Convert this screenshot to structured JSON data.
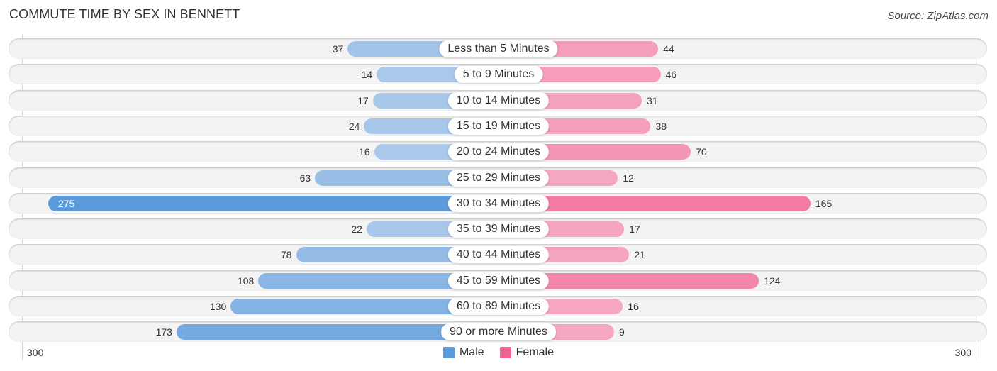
{
  "chart_data": {
    "type": "bar",
    "orientation": "horizontal-diverging",
    "title": "COMMUTE TIME BY SEX IN BENNETT",
    "source": "Source: ZipAtlas.com",
    "categories": [
      "Less than 5 Minutes",
      "5 to 9 Minutes",
      "10 to 14 Minutes",
      "15 to 19 Minutes",
      "20 to 24 Minutes",
      "25 to 29 Minutes",
      "30 to 34 Minutes",
      "35 to 39 Minutes",
      "40 to 44 Minutes",
      "45 to 59 Minutes",
      "60 to 89 Minutes",
      "90 or more Minutes"
    ],
    "series": [
      {
        "name": "Male",
        "color": "#5b9bdc",
        "light_color": "#aecbeb",
        "values": [
          37,
          14,
          17,
          24,
          16,
          63,
          275,
          22,
          78,
          108,
          130,
          173
        ]
      },
      {
        "name": "Female",
        "color": "#f06492",
        "light_color": "#f6aac2",
        "values": [
          44,
          46,
          31,
          38,
          70,
          12,
          165,
          17,
          21,
          124,
          16,
          9
        ]
      }
    ],
    "axis": {
      "left_tick": "300",
      "right_tick": "300",
      "max": 300
    },
    "legend": {
      "position": "bottom-center",
      "items": [
        "Male",
        "Female"
      ]
    },
    "grid": false
  }
}
